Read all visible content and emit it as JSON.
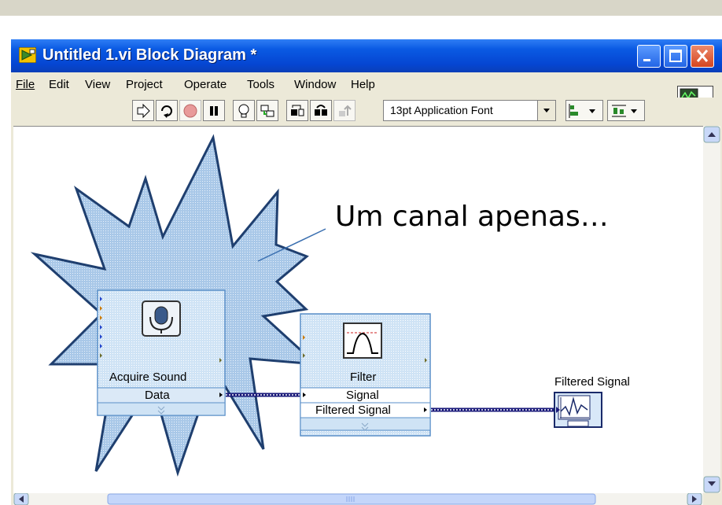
{
  "window": {
    "title": "Untitled 1.vi Block Diagram *"
  },
  "menu": {
    "items": [
      {
        "label": "File"
      },
      {
        "label": "Edit"
      },
      {
        "label": "View"
      },
      {
        "label": "Project"
      },
      {
        "label": "Operate"
      },
      {
        "label": "Tools"
      },
      {
        "label": "Window"
      },
      {
        "label": "Help"
      }
    ]
  },
  "toolbar": {
    "font_select": "13pt Application Font"
  },
  "annotation": {
    "text": "Um canal apenas…"
  },
  "nodes": {
    "acquire": {
      "title": "Acquire Sound",
      "output": "Data"
    },
    "filter": {
      "title": "Filter",
      "input": "Signal",
      "output": "Filtered Signal"
    },
    "graph": {
      "label": "Filtered Signal"
    }
  },
  "colors": {
    "titlebar": "#0a5ae3",
    "wire": "#1a1a7a",
    "node_fill": "#cfe3f5",
    "node_border": "#5a8fc8",
    "star_fill": "#a9c8e8"
  },
  "icons": {
    "title": "labview-vi-icon",
    "run": "run-arrow-icon",
    "run_continuous": "run-continuously-icon",
    "abort": "abort-icon",
    "pause": "pause-icon",
    "highlight": "highlight-execution-icon",
    "retain": "retain-wire-values-icon",
    "step_into": "step-into-icon",
    "step_over": "step-over-icon",
    "step_out": "step-out-icon",
    "align": "align-objects-icon",
    "distribute": "distribute-objects-icon",
    "microphone": "microphone-icon",
    "filter": "bandpass-filter-icon",
    "graph": "waveform-graph-icon"
  }
}
